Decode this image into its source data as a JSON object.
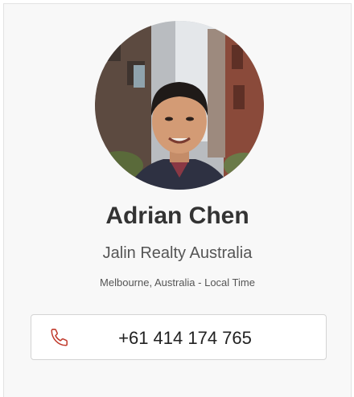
{
  "agent": {
    "name": "Adrian Chen",
    "company": "Jalin Realty Australia",
    "location": "Melbourne, Australia - Local Time"
  },
  "contact": {
    "phone": "+61 414 174 765",
    "icon": "phone-icon"
  },
  "colors": {
    "card_background": "#f8f8f8",
    "accent_icon": "#c0392b",
    "name_text": "#333333",
    "secondary_text": "#555555"
  }
}
